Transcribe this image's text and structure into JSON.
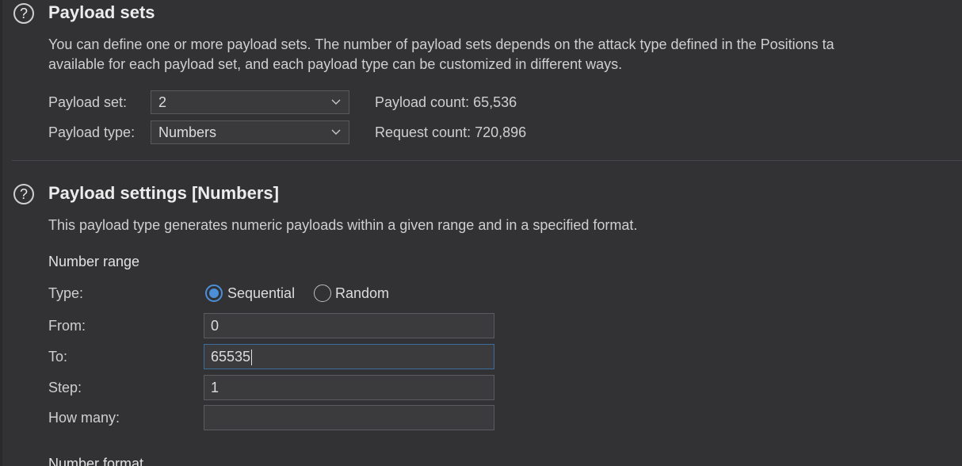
{
  "payload_sets": {
    "help_icon": "question-circle-icon",
    "title": "Payload sets",
    "description_line1": "You can define one or more payload sets. The number of payload sets depends on the attack type defined in the Positions ta",
    "description_line2": "available for each payload set, and each payload type can be customized in different ways.",
    "set_label": "Payload set:",
    "set_value": "2",
    "type_label": "Payload type:",
    "type_value": "Numbers",
    "payload_count": "Payload count: 65,536",
    "request_count": "Request count: 720,896"
  },
  "payload_settings": {
    "help_icon": "question-circle-icon",
    "title": "Payload settings [Numbers]",
    "description": "This payload type generates numeric payloads within a given range and in a specified format.",
    "number_range_heading": "Number range",
    "type_label": "Type:",
    "sequential_label": "Sequential",
    "random_label": "Random",
    "selected_type": "Sequential",
    "from_label": "From:",
    "from_value": "0",
    "to_label": "To:",
    "to_value": "65535",
    "step_label": "Step:",
    "step_value": "1",
    "how_many_label": "How many:",
    "how_many_value": "",
    "number_format_heading": "Number format"
  },
  "colors": {
    "background": "#323235",
    "accent": "#4a8fd8",
    "focus_border": "#3c6d9c"
  }
}
